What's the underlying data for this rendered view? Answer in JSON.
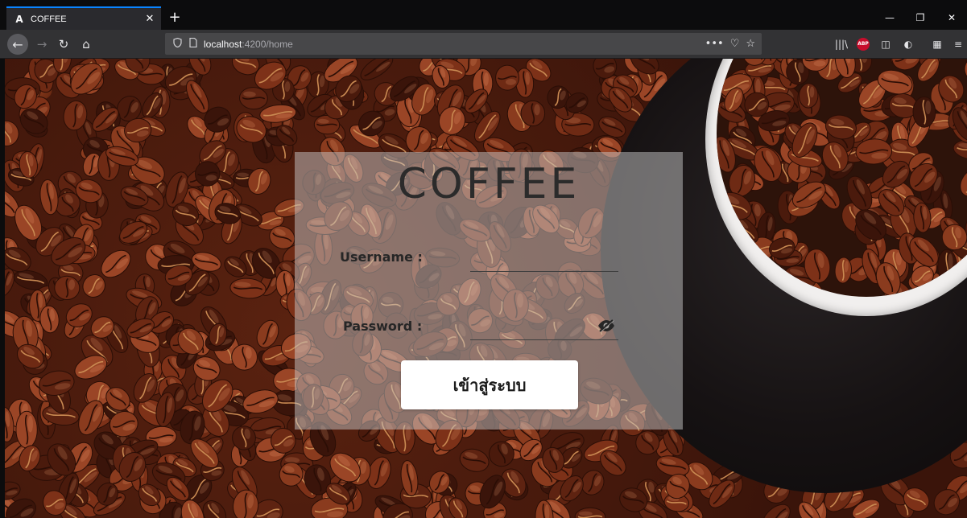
{
  "browser": {
    "tab": {
      "favicon_letter": "A",
      "title": "COFFEE",
      "close_glyph": "✕"
    },
    "new_tab_glyph": "+",
    "window_controls": {
      "minimize": "—",
      "restore": "❐",
      "close": "✕"
    },
    "nav": {
      "back": "←",
      "forward": "→",
      "reload": "↻",
      "home": "⌂"
    },
    "url": {
      "host": "localhost",
      "path": ":4200/home"
    },
    "url_right_icons": {
      "more": "•••",
      "pocket": "♡",
      "bookmark": "☆"
    },
    "toolbar": {
      "library": "|||\\",
      "abp": "ABP",
      "sidebar": "◫",
      "extension": "◐",
      "extension2": "▦",
      "menu": "≡"
    }
  },
  "login": {
    "brand": "COFFEE",
    "username_label": "Username :",
    "username_value": "",
    "password_label": "Password :",
    "password_value": "",
    "submit_label": "เข้าสู่ระบบ"
  },
  "colors": {
    "tab_accent": "#0a84ff",
    "card_overlay": "rgba(200,200,200,0.5)",
    "button_bg": "#ffffff"
  }
}
